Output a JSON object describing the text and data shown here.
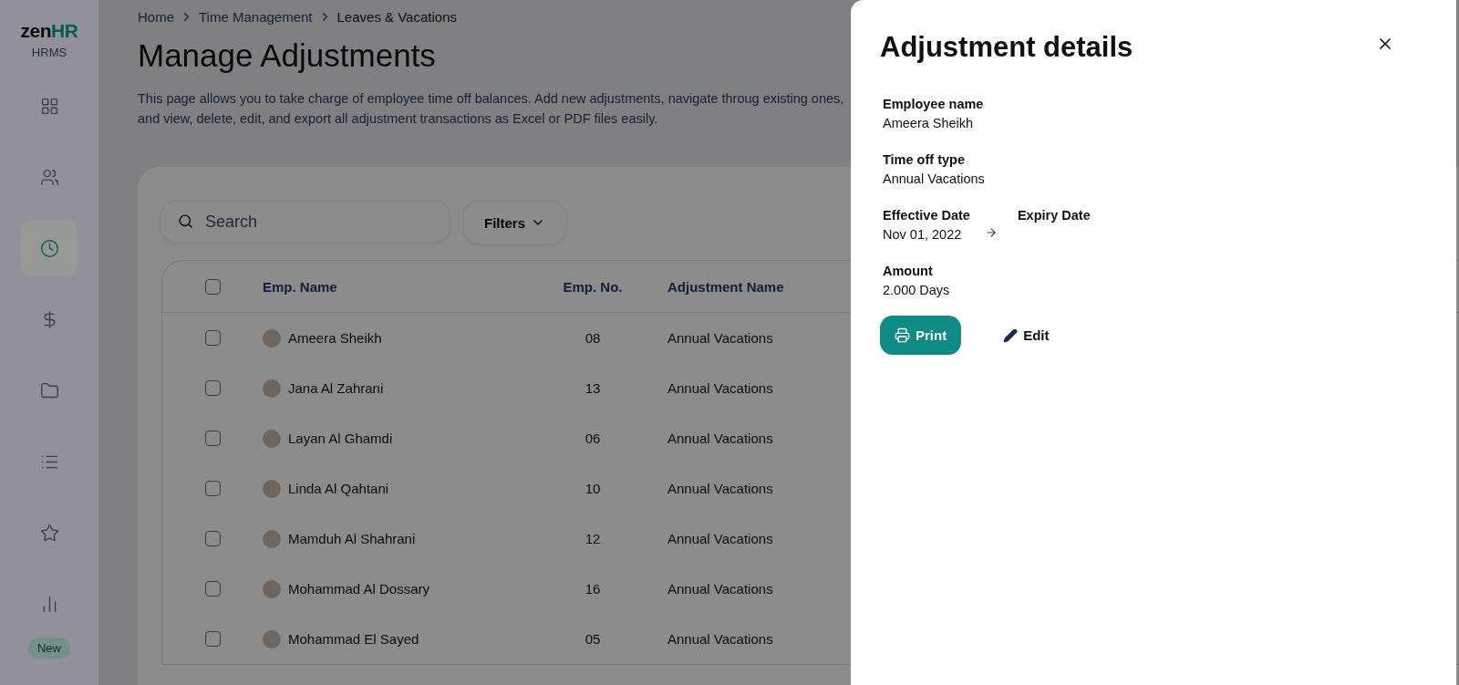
{
  "sidebar": {
    "logo": {
      "part_1": "zen",
      "part_2": "HR"
    },
    "product": "HRMS",
    "items": [
      {
        "kind": "grid",
        "selected": false
      },
      {
        "kind": "users",
        "selected": false
      },
      {
        "kind": "clock",
        "selected": true
      },
      {
        "kind": "dollar",
        "selected": false
      },
      {
        "kind": "folder",
        "selected": false
      },
      {
        "kind": "list",
        "selected": false
      },
      {
        "kind": "star",
        "selected": false
      },
      {
        "kind": "chart",
        "selected": false
      }
    ],
    "badge": "New"
  },
  "breadcrumb": [
    "Home",
    "Time Management",
    "Leaves & Vacations"
  ],
  "page_title": "Manage Adjustments",
  "description": "This page allows you to take charge of employee time off balances. Add new adjustments, navigate throug existing ones, and view, delete, edit, and export all adjustment transactions as Excel or PDF files easily.",
  "search": {
    "placeholder": "Search"
  },
  "filters_button": "Filters",
  "table": {
    "select_all_checked": false,
    "columns": [
      "Emp. Name",
      "Emp. No.",
      "Adjustment Name"
    ],
    "rows": [
      {
        "name": "Ameera Sheikh",
        "number": "08",
        "adjustment": "Annual Vacations",
        "checked": false
      },
      {
        "name": "Jana Al Zahrani",
        "number": "13",
        "adjustment": "Annual Vacations",
        "checked": false
      },
      {
        "name": "Layan Al Ghamdi",
        "number": "06",
        "adjustment": "Annual Vacations",
        "checked": false
      },
      {
        "name": "Linda Al Qahtani",
        "number": "10",
        "adjustment": "Annual Vacations",
        "checked": false
      },
      {
        "name": "Mamduh Al Shahrani",
        "number": "12",
        "adjustment": "Annual Vacations",
        "checked": false
      },
      {
        "name": "Mohammad Al Dossary",
        "number": "16",
        "adjustment": "Annual Vacations",
        "checked": false
      },
      {
        "name": "Mohammad El Sayed",
        "number": "05",
        "adjustment": "Annual Vacations",
        "checked": false
      }
    ]
  },
  "drawer": {
    "title": "Adjustment details",
    "employee": {
      "label": "Employee name",
      "value": "Ameera Sheikh"
    },
    "time_off": {
      "label": "Time off type",
      "value": "Annual Vacations"
    },
    "effective": {
      "label": "Effective Date",
      "value": "Nov 01, 2022"
    },
    "expiry": {
      "label": "Expiry Date"
    },
    "amount": {
      "label": "Amount",
      "value": "2.000 Days"
    },
    "print_button": "Print",
    "edit_button": "Edit"
  }
}
